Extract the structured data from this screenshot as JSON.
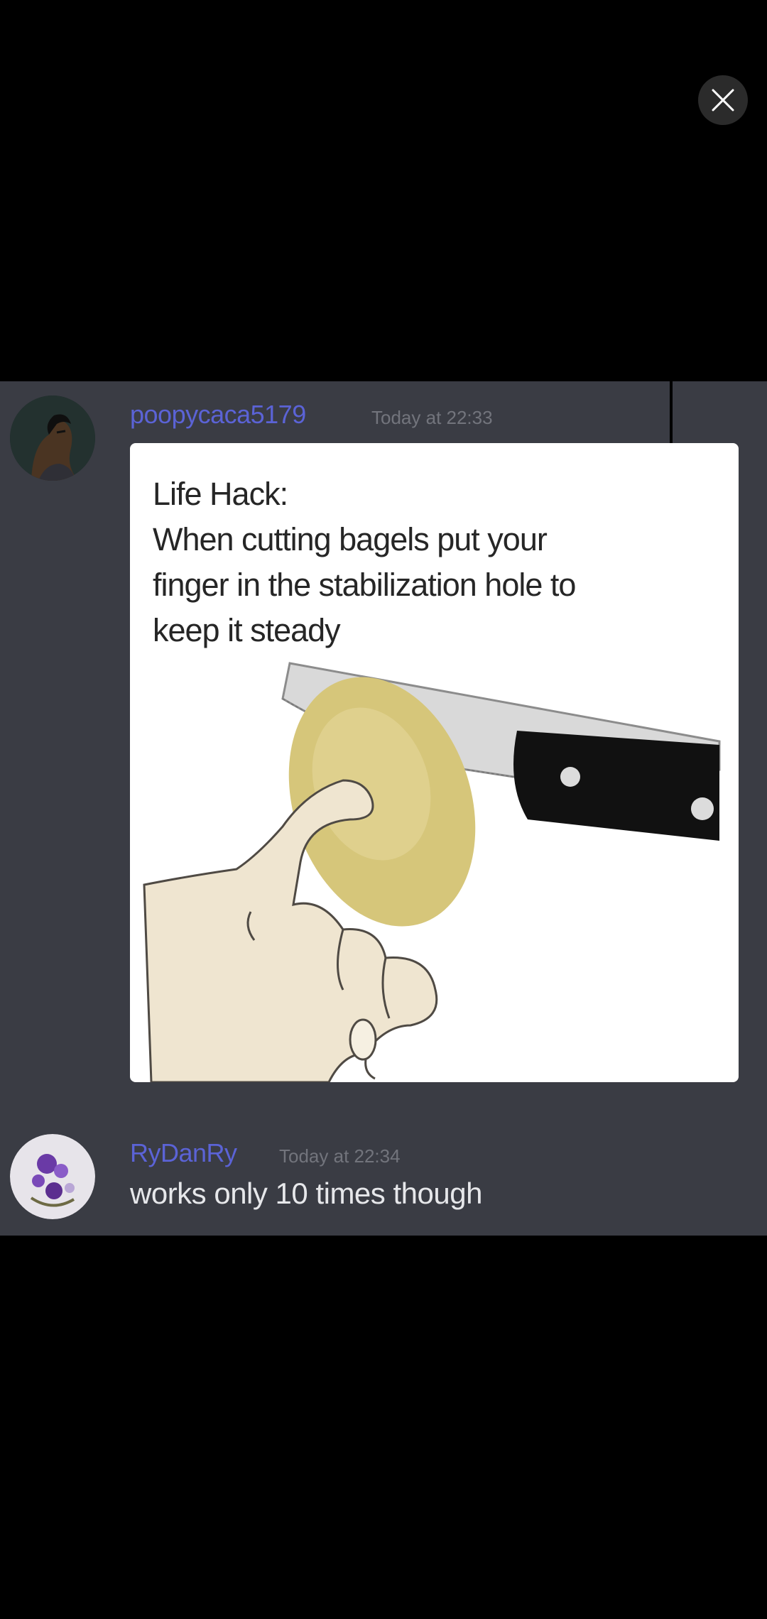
{
  "viewer": {
    "close_icon": "close-icon"
  },
  "messages": [
    {
      "username": "poopycaca5179",
      "username_color": "#5b63d6",
      "timestamp": "Today at 22:33",
      "avatar_icon": "avatar-bust-icon",
      "embed": {
        "lines": [
          "Life Hack:",
          "When cutting bagels put your",
          "finger in the stabilization hole to",
          "keep it steady"
        ]
      }
    },
    {
      "username": "RyDanRy",
      "username_color": "#5b63d6",
      "timestamp": "Today at 22:34",
      "avatar_icon": "avatar-flowers-icon",
      "text": "works only 10 times though"
    }
  ],
  "colors": {
    "page_background": "#000000",
    "chat_background": "#3a3c44",
    "close_button_background": "#2b2b2b"
  }
}
